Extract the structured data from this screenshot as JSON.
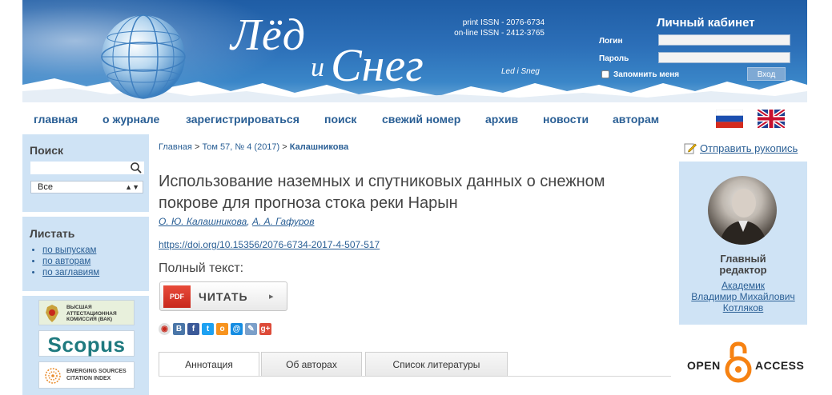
{
  "header": {
    "logo_line1": "Лёд",
    "logo_line2_small": "и",
    "logo_line2": "Снег",
    "issn_print": "print ISSN - 2076-6734",
    "issn_online": "on-line ISSN - 2412-3765",
    "subtitle": "Led i Sneg",
    "cabinet_title": "Личный кабинет",
    "login_label": "Логин",
    "password_label": "Пароль",
    "remember_label": "Запомнить меня",
    "login_button": "Вход"
  },
  "nav": {
    "items": [
      "главная",
      "о журнале",
      "зарегистрироваться",
      "поиск",
      "свежий номер",
      "архив",
      "новости",
      "авторам"
    ]
  },
  "left": {
    "search_title": "Поиск",
    "search_placeholder": "",
    "select_value": "Все",
    "browse_title": "Листать",
    "browse_items": [
      "по выпускам",
      "по авторам",
      "по заглавиям"
    ],
    "vak_text": "ВЫСШАЯ АТТЕСТАЦИОННАЯ КОМИССИЯ (ВАК)",
    "scopus_text": "Scopus",
    "esci_line1": "EMERGING SOURCES",
    "esci_line2": "CITATION INDEX"
  },
  "breadcrumb": {
    "home": "Главная",
    "sep": ">",
    "issue": "Том 57, № 4 (2017)",
    "current": "Калашникова"
  },
  "article": {
    "title": "Использование наземных и спутниковых данных о снежном покрове для прогноза стока реки Нарын",
    "author1": "О. Ю. Калашникова",
    "author_sep": ",",
    "author2": "А. А. Гафуров",
    "doi": "https://doi.org/10.15356/2076-6734-2017-4-507-517",
    "fulltext_label": "Полный текст:",
    "pdf_tag": "PDF",
    "read_button": "ЧИТАТЬ"
  },
  "share": [
    "vk",
    "fb",
    "tw",
    "ok",
    "mail",
    "lj",
    "gplus"
  ],
  "tabs": [
    "Аннотация",
    "Об авторах",
    "Список литературы"
  ],
  "right": {
    "submit_link": "Отправить рукопись",
    "editor_title_line1": "Главный",
    "editor_title_line2": "редактор",
    "editor_name_line1": "Академик",
    "editor_name_line2": "Владимир Михайлович",
    "editor_name_line3": "Котляков",
    "oa_open": "OPEN",
    "oa_access": "ACCESS"
  },
  "colors": {
    "link": "#2a5f95",
    "sidebar_bg": "#cfe3f5",
    "banner": "#2c6fb8"
  }
}
